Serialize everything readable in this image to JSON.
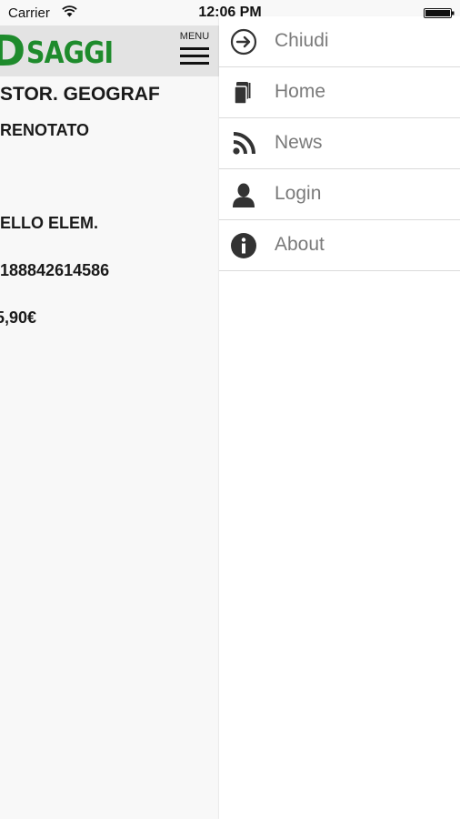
{
  "status_bar": {
    "carrier": "Carrier",
    "time": "12:06 PM"
  },
  "header": {
    "logo_mark": "D",
    "logo_text": "SAGGI",
    "menu_label": "MENU",
    "brand_color": "#1e8b2c"
  },
  "detail": {
    "line1": "STOR. GEOGRAF",
    "line2": "RENOTATO",
    "line3": "ELLO ELEM.",
    "line4": "188842614586",
    "line5": "5,90€"
  },
  "side_menu": {
    "items": [
      {
        "label": "Chiudi",
        "icon": "arrow-right-circle-icon"
      },
      {
        "label": "Home",
        "icon": "books-icon"
      },
      {
        "label": "News",
        "icon": "rss-icon"
      },
      {
        "label": "Login",
        "icon": "user-icon"
      },
      {
        "label": "About",
        "icon": "info-icon"
      }
    ]
  }
}
